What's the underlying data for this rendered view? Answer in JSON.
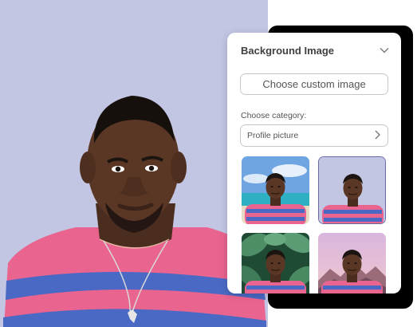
{
  "panel": {
    "title": "Background Image",
    "custom_button_label": "Choose custom image",
    "category_label": "Choose category:",
    "category_value": "Profile picture",
    "header_icon": "chevron-down-icon",
    "select_icon": "chevron-right-icon"
  },
  "thumbnails": [
    {
      "name": "beach",
      "selected": false
    },
    {
      "name": "plain-lavender",
      "selected": true
    },
    {
      "name": "tropical-leaves",
      "selected": false
    },
    {
      "name": "mountains-sunset",
      "selected": false
    }
  ],
  "colors": {
    "background": "#c2c6e3",
    "panel": "#ffffff",
    "selected_border": "#6a6aa8",
    "shirt_pink": "#e9648f",
    "shirt_blue": "#4a69c4"
  }
}
